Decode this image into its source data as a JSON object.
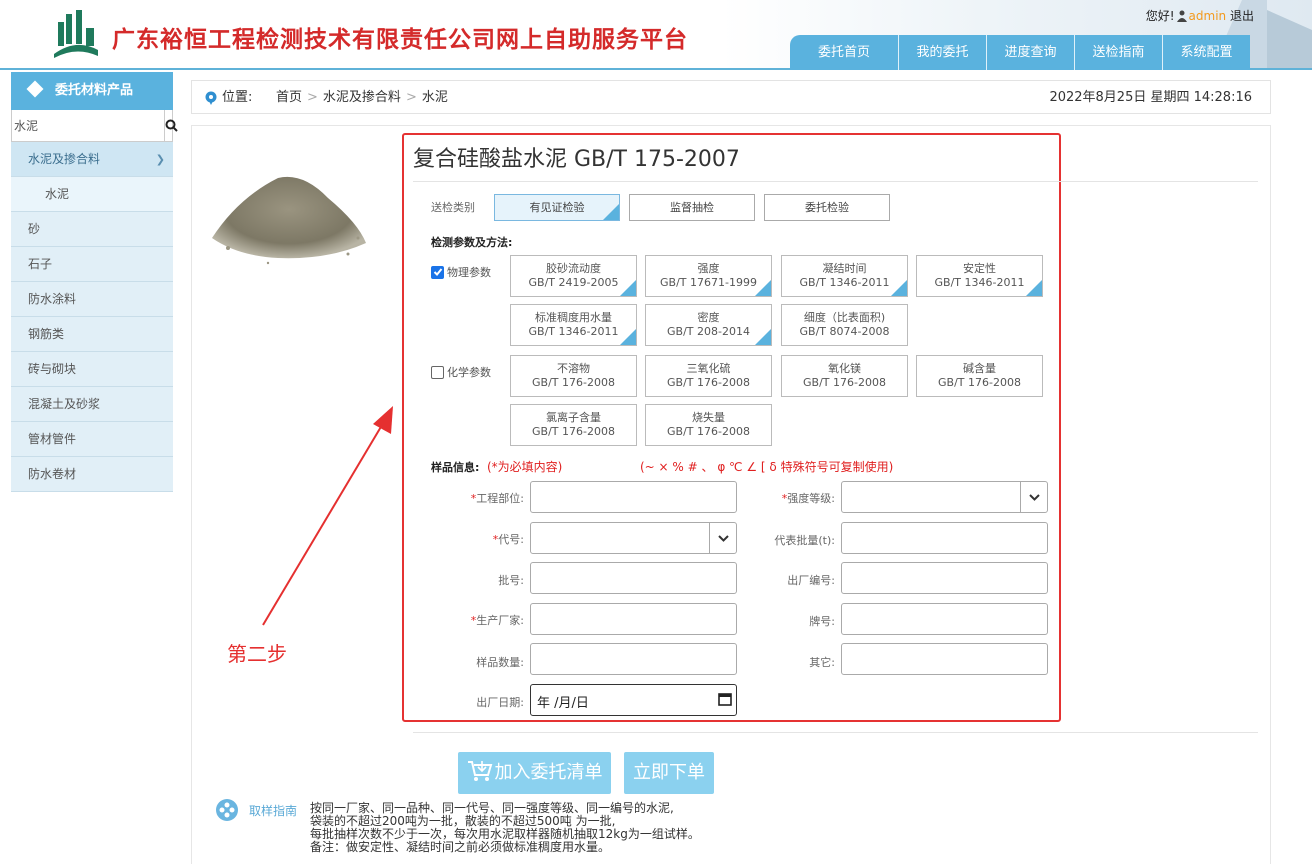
{
  "header": {
    "title": "广东裕恒工程检测技术有限责任公司网上自助服务平台",
    "greeting": "您好!",
    "username": "admin",
    "logout": "退出",
    "nav": [
      "委托首页",
      "我的委托",
      "进度查询",
      "送检指南",
      "系统配置"
    ]
  },
  "sidebar": {
    "heading": "委托材料产品",
    "search_value": "水泥",
    "items": [
      {
        "label": "水泥及掺合料",
        "state": "expanded"
      },
      {
        "label": "水泥",
        "state": "sub"
      },
      {
        "label": "砂"
      },
      {
        "label": "石子"
      },
      {
        "label": "防水涂料"
      },
      {
        "label": "钢筋类"
      },
      {
        "label": "砖与砌块"
      },
      {
        "label": "混凝土及砂浆"
      },
      {
        "label": "管材管件"
      },
      {
        "label": "防水卷材"
      }
    ]
  },
  "breadcrumb": {
    "label": "位置:",
    "items": [
      "首页",
      "水泥及掺合料",
      "水泥"
    ],
    "sep": ">",
    "datetime": "2022年8月25日 星期四 14:28:16"
  },
  "product": {
    "title": "复合硅酸盐水泥 GB/T 175-2007",
    "type_label": "送检类别",
    "types": [
      {
        "label": "有见证检验",
        "selected": true
      },
      {
        "label": "监督抽检",
        "selected": false
      },
      {
        "label": "委托检验",
        "selected": false
      }
    ],
    "params_label": "检测参数及方法:",
    "physical": {
      "label": "物理参数",
      "checked": true,
      "items": [
        {
          "name": "胶砂流动度",
          "std": "GB/T 2419-2005",
          "selected": true
        },
        {
          "name": "强度",
          "std": "GB/T 17671-1999",
          "selected": true
        },
        {
          "name": "凝结时间",
          "std": "GB/T 1346-2011",
          "selected": true
        },
        {
          "name": "安定性",
          "std": "GB/T 1346-2011",
          "selected": true
        },
        {
          "name": "标准稠度用水量",
          "std": "GB/T 1346-2011",
          "selected": true
        },
        {
          "name": "密度",
          "std": "GB/T 208-2014",
          "selected": true
        },
        {
          "name": "细度（比表面积)",
          "std": "GB/T 8074-2008",
          "selected": false
        }
      ]
    },
    "chemical": {
      "label": "化学参数",
      "checked": false,
      "items": [
        {
          "name": "不溶物",
          "std": "GB/T 176-2008"
        },
        {
          "name": "三氧化硫",
          "std": "GB/T 176-2008"
        },
        {
          "name": "氧化镁",
          "std": "GB/T 176-2008"
        },
        {
          "name": "碱含量",
          "std": "GB/T 176-2008"
        },
        {
          "name": "氯离子含量",
          "std": "GB/T 176-2008"
        },
        {
          "name": "烧失量",
          "std": "GB/T 176-2008"
        }
      ]
    },
    "sample_label": "样品信息:",
    "required_note": "(*为必填内容)",
    "symbols_note": "(~ × % # 、 φ ℃ ∠ [ δ 特殊符号可复制使用)",
    "fields": {
      "project_part": {
        "label": "工程部位:",
        "required": true,
        "value": ""
      },
      "strength_grade": {
        "label": "强度等级:",
        "required": true,
        "value": ""
      },
      "code": {
        "label": "代号:",
        "required": true,
        "value": ""
      },
      "batch_qty": {
        "label": "代表批量(t):",
        "required": false,
        "value": ""
      },
      "batch_no": {
        "label": "批号:",
        "required": false,
        "value": ""
      },
      "factory_no": {
        "label": "出厂编号:",
        "required": false,
        "value": ""
      },
      "manufacturer": {
        "label": "生产厂家:",
        "required": true,
        "value": ""
      },
      "brand": {
        "label": "牌号:",
        "required": false,
        "value": ""
      },
      "sample_qty": {
        "label": "样品数量:",
        "required": false,
        "value": ""
      },
      "other": {
        "label": "其它:",
        "required": false,
        "value": ""
      },
      "factory_date": {
        "label": "出厂日期:",
        "required": false,
        "value": "年 /月/日"
      }
    },
    "add_button": "加入委托清单",
    "order_button": "立即下单"
  },
  "annotation": {
    "text": "第二步",
    "color": "#e53030"
  },
  "guide": {
    "title": "取样指南",
    "lines": [
      "按同一厂家、同一品种、同一代号、同一强度等级、同一编号的水泥,",
      "袋装的不超过200吨为一批，散装的不超过500吨 为一批,",
      "每批抽样次数不少于一次，每次用水泥取样器随机抽取12kg为一组试样。",
      "备注：做安定性、凝结时间之前必须做标准稠度用水量。"
    ]
  },
  "colors": {
    "accent": "#5ab2de",
    "brand_red": "#d42a2a",
    "highlight_box": "#e53232"
  }
}
